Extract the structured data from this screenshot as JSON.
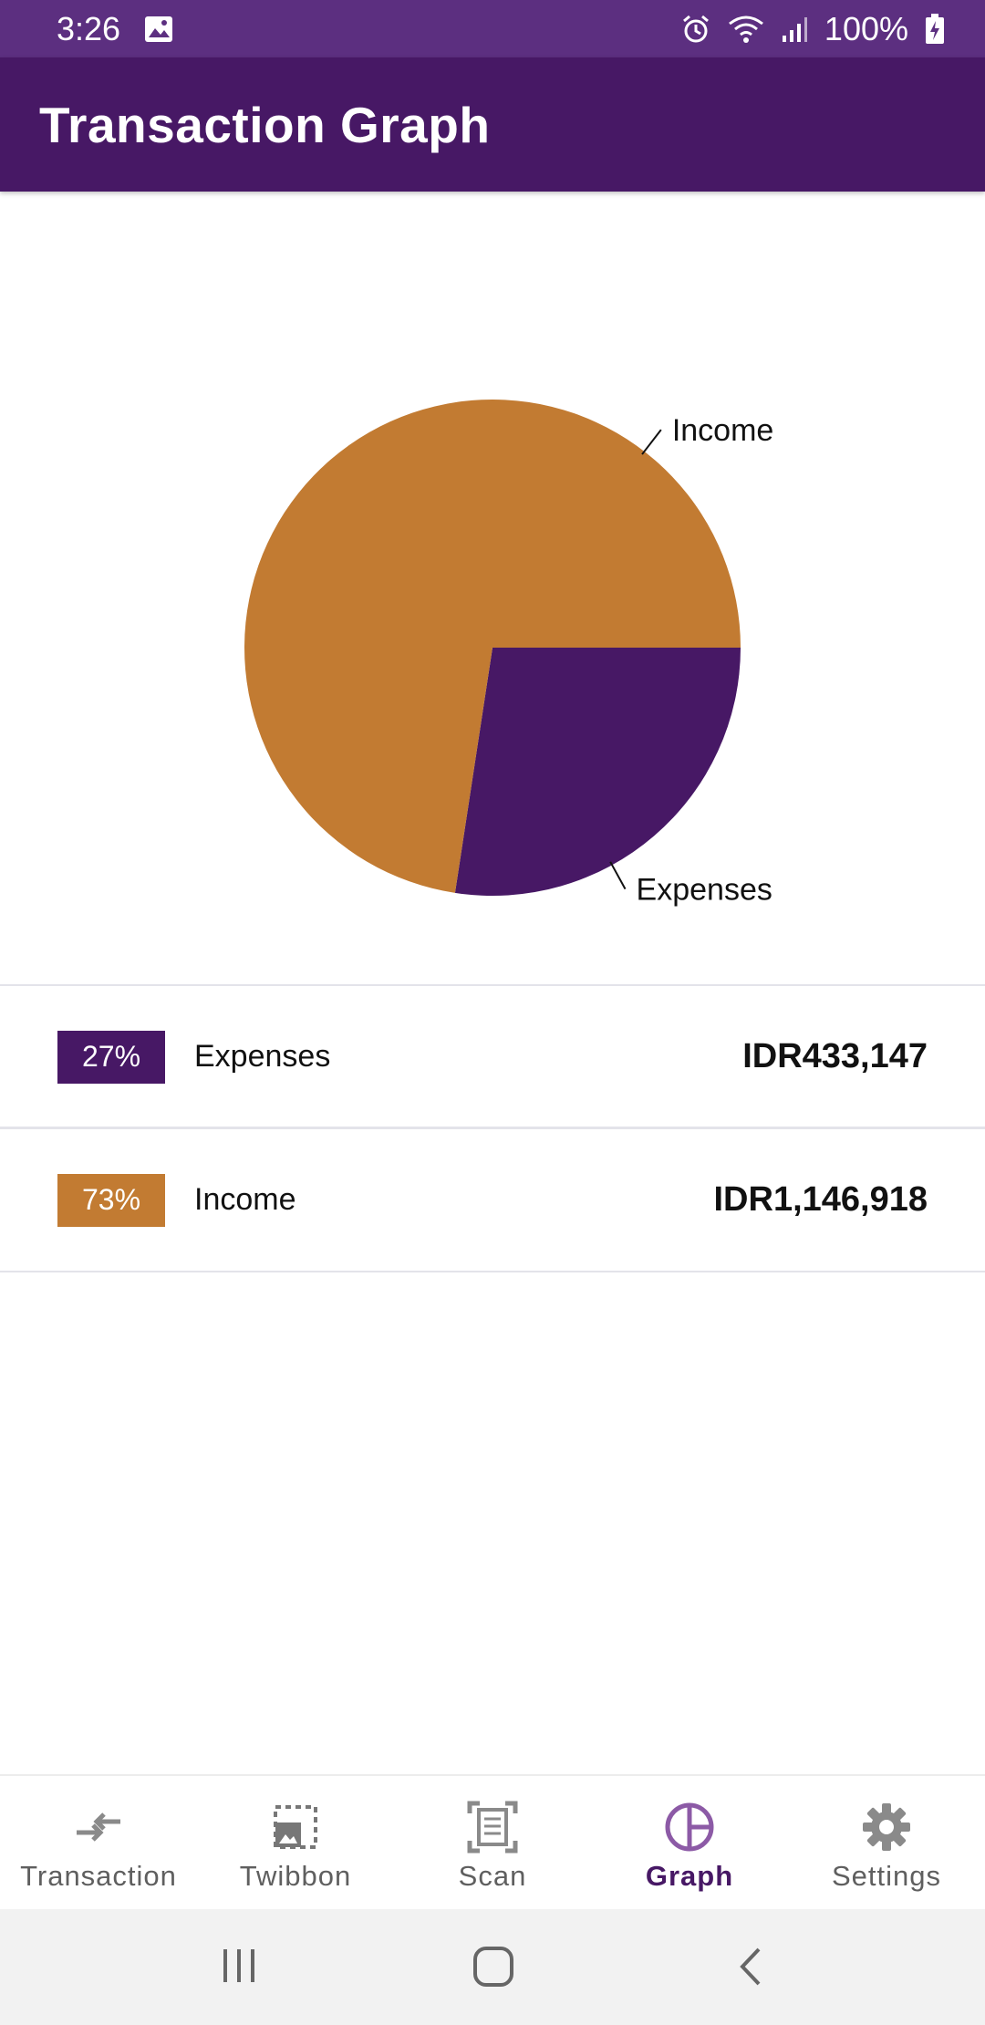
{
  "status_bar": {
    "time": "3:26",
    "battery": "100%",
    "icons": [
      "image-icon",
      "alarm-icon",
      "wifi-icon",
      "signal-icon",
      "battery-charging-icon"
    ]
  },
  "app_bar": {
    "title": "Transaction Graph"
  },
  "colors": {
    "expenses": "#471865",
    "income": "#c27b32",
    "status_bar": "#5c2f80",
    "app_bar": "#471865"
  },
  "chart_data": {
    "type": "pie",
    "slices": [
      {
        "label": "Income",
        "value": 1146918,
        "percent": 73,
        "color": "#c27b32"
      },
      {
        "label": "Expenses",
        "value": 433147,
        "percent": 27,
        "color": "#471865"
      }
    ]
  },
  "legend": [
    {
      "percent": "27%",
      "label": "Expenses",
      "amount": "IDR433,147"
    },
    {
      "percent": "73%",
      "label": "Income",
      "amount": "IDR1,146,918"
    }
  ],
  "bottom_nav": {
    "items": [
      {
        "label": "Transaction",
        "icon": "transfer-arrows-icon",
        "active": false
      },
      {
        "label": "Twibbon",
        "icon": "frame-image-icon",
        "active": false
      },
      {
        "label": "Scan",
        "icon": "scan-document-icon",
        "active": false
      },
      {
        "label": "Graph",
        "icon": "pie-chart-icon",
        "active": true
      },
      {
        "label": "Settings",
        "icon": "gear-icon",
        "active": false
      }
    ]
  },
  "system_nav": {
    "buttons": [
      "recents-icon",
      "home-icon",
      "back-icon"
    ]
  }
}
